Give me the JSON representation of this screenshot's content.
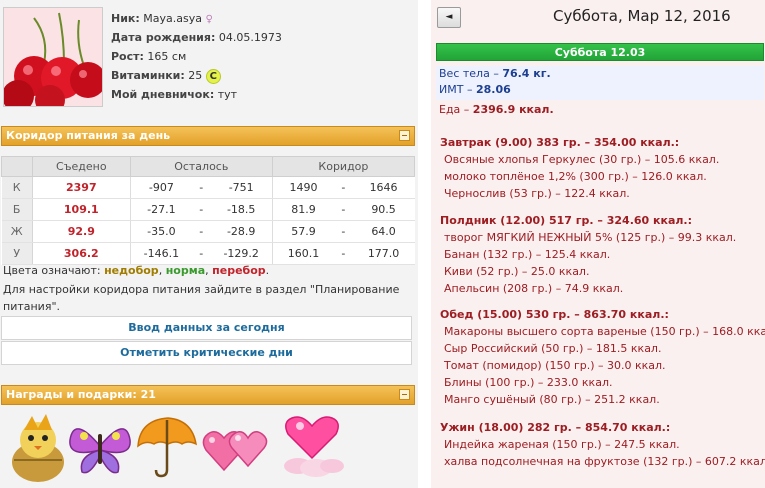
{
  "profile": {
    "nick_label": "Ник:",
    "nick_value": "Maya.asya",
    "gender_symbol": "♀",
    "birth_label": "Дата рождения:",
    "birth_value": "04.05.1973",
    "height_label": "Рост:",
    "height_value": "165 см",
    "vitamins_label": "Витаминки:",
    "vitamins_value": "25",
    "vitamins_badge": "C",
    "diary_label": "Мой дневничок:",
    "diary_value": "тут"
  },
  "corridor": {
    "title": "Коридор питания за день",
    "headers": [
      "Съедено",
      "Осталось",
      "Коридор"
    ],
    "rows": [
      {
        "label": "К",
        "eaten": "2397",
        "left_a": "-907",
        "left_b": "-751",
        "corr_a": "1490",
        "corr_b": "1646"
      },
      {
        "label": "Б",
        "eaten": "109.1",
        "left_a": "-27.1",
        "left_b": "-18.5",
        "corr_a": "81.9",
        "corr_b": "90.5"
      },
      {
        "label": "Ж",
        "eaten": "92.9",
        "left_a": "-35.0",
        "left_b": "-28.9",
        "corr_a": "57.9",
        "corr_b": "64.0"
      },
      {
        "label": "У",
        "eaten": "306.2",
        "left_a": "-146.1",
        "left_b": "-129.2",
        "corr_a": "160.1",
        "corr_b": "177.0"
      }
    ],
    "dash": "-",
    "legend_prefix": "Цвета означают:",
    "legend_under": "недобор",
    "legend_norm": "норма",
    "legend_over": "перебор",
    "comma": ",",
    "period": ".",
    "hint": "Для настройки коридора питания зайдите в раздел \"Планирование питания\".",
    "enter_data_label": "Ввод данных за сегодня",
    "critical_days_label": "Отметить критические дни"
  },
  "rewards": {
    "title": "Награды и подарки: 21"
  },
  "day": {
    "prev_label": "◄",
    "title": "Суббота, Мар 12, 2016",
    "bar_label": "Суббота 12.03",
    "weight_label": "Вес тела",
    "weight_value": "76.4 кг.",
    "bmi_label": "ИМТ",
    "bmi_value": "28.06",
    "dash_sep": "–",
    "food_label": "Еда –",
    "food_value": "2396.9 ккал."
  },
  "meals": [
    {
      "header": "Завтрак (9.00) 383 гр. – 354.00 ккал.:",
      "items": [
        "Овсяные хлопья Геркулес (30 гр.) – 105.6 ккал.",
        "молоко топлёное 1,2% (300 гр.) – 126.0 ккал.",
        "Чернослив (53 гр.) – 122.4 ккал."
      ]
    },
    {
      "header": "Полдник (12.00) 517 гр. – 324.60 ккал.:",
      "items": [
        "творог МЯГКИЙ НЕЖНЫЙ 5% (125 гр.) – 99.3 ккал.",
        "Банан (132 гр.) – 125.4 ккал.",
        "Киви (52 гр.) – 25.0 ккал.",
        "Апельсин (208 гр.) – 74.9 ккал."
      ]
    },
    {
      "header": "Обед (15.00) 530 гр. – 863.70 ккал.:",
      "items": [
        "Макароны высшего сорта вареные (150 гр.) – 168.0 ккал.",
        "Сыр Российский (50 гр.) – 181.5 ккал.",
        "Томат (помидор) (150 гр.) – 30.0 ккал.",
        "Блины (100 гр.) – 233.0 ккал.",
        "Манго сушёный (80 гр.) – 251.2 ккал."
      ]
    },
    {
      "header": "Ужин (18.00) 282 гр. – 854.70 ккал.:",
      "items": [
        "Индейка жареная (150 гр.) – 247.5 ккал.",
        "халва подсолнечная на фруктозе (132 гр.) – 607.2 ккал."
      ]
    }
  ],
  "icons": {
    "avatar": "cherries-avatar-icon",
    "gifts": [
      "chick-scarecrow-icon",
      "butterfly-icon",
      "umbrella-icon",
      "two-hearts-icon",
      "heart-cloud-icon"
    ]
  },
  "colors": {
    "panel_orange": "#e3a12a",
    "day_green": "#22a437",
    "eaten_red": "#c0232b",
    "under_color": "#a07d00",
    "norm_color": "#3a9a2d",
    "over_color": "#c0232b"
  }
}
